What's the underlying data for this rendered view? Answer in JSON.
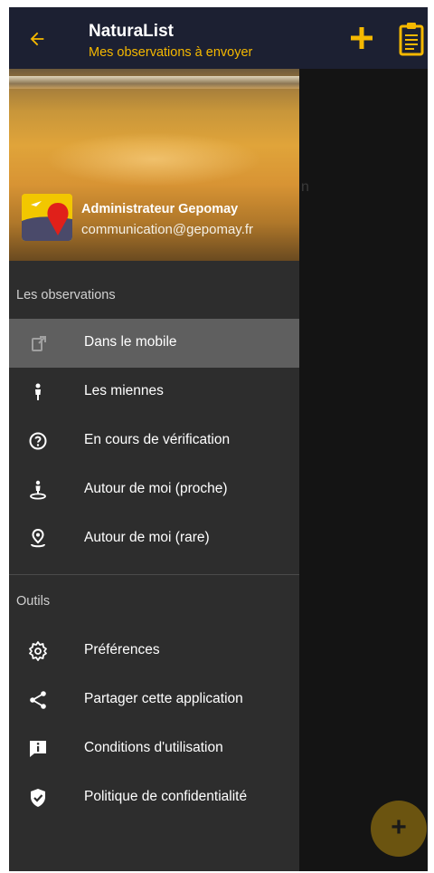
{
  "appbar": {
    "title": "NaturaList",
    "subtitle": "Mes observations à envoyer",
    "back_icon": "arrow-left-icon",
    "actions": [
      "plus-icon",
      "clipboard-icon"
    ],
    "accent": "#f5b800",
    "background": "#1c2032"
  },
  "behind": {
    "partial_text": "n"
  },
  "drawer": {
    "user": {
      "name": "Administrateur Gepomay",
      "email": "communication@gepomay.fr"
    },
    "sections": [
      {
        "title": "Les observations"
      },
      {
        "title": "Outils"
      }
    ],
    "items": [
      {
        "label": "Dans le mobile",
        "icon": "phone-icon",
        "active": true
      },
      {
        "label": "Les miennes",
        "icon": "person-icon"
      },
      {
        "label": "En cours de vérification",
        "icon": "question-circle-icon"
      },
      {
        "label": "Autour de moi (proche)",
        "icon": "person-location-icon"
      },
      {
        "label": "Autour de moi (rare)",
        "icon": "location-pin-icon"
      },
      {
        "label": "Préférences",
        "icon": "gear-icon"
      },
      {
        "label": "Partager cette application",
        "icon": "share-icon"
      },
      {
        "label": "Conditions d'utilisation",
        "icon": "info-message-icon"
      },
      {
        "label": "Politique de confidentialité",
        "icon": "shield-check-icon"
      }
    ]
  },
  "fab": {
    "label": "+",
    "color": "#6b5410"
  }
}
